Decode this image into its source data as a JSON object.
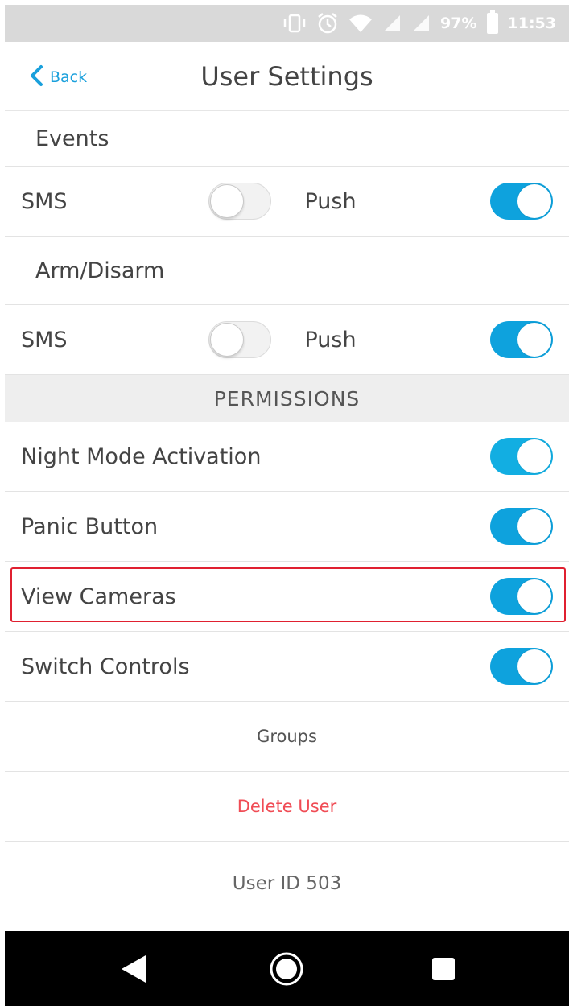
{
  "status_bar": {
    "battery_percent": "97%",
    "time": "11:53",
    "icons": [
      "vibrate-icon",
      "alarm-icon",
      "wifi-icon",
      "signal-icon",
      "signal-icon",
      "battery-icon"
    ]
  },
  "header": {
    "back_label": "Back",
    "title": "User Settings"
  },
  "notifications": {
    "events": {
      "label": "Events",
      "sms_label": "SMS",
      "sms_enabled": false,
      "push_label": "Push",
      "push_enabled": true
    },
    "arm_disarm": {
      "label": "Arm/Disarm",
      "sms_label": "SMS",
      "sms_enabled": false,
      "push_label": "Push",
      "push_enabled": true
    }
  },
  "permissions": {
    "header": "PERMISSIONS",
    "items": [
      {
        "label": "Night Mode Activation",
        "enabled": true
      },
      {
        "label": "Panic Button",
        "enabled": true
      },
      {
        "label": "View Cameras",
        "enabled": true,
        "highlighted": true
      },
      {
        "label": "Switch Controls",
        "enabled": true
      }
    ]
  },
  "actions": {
    "groups_label": "Groups",
    "delete_label": "Delete User"
  },
  "footer": {
    "user_id": "User ID 503"
  },
  "colors": {
    "accent": "#0ea2dd",
    "back_link": "#1aa0dc",
    "delete": "#f04c55",
    "highlight": "#e02030",
    "status_bar_bg": "#d9d9d9",
    "section_bg": "#eeeeee"
  },
  "system_nav": {
    "icons": [
      "back-triangle-icon",
      "home-circle-icon",
      "recents-square-icon"
    ]
  }
}
